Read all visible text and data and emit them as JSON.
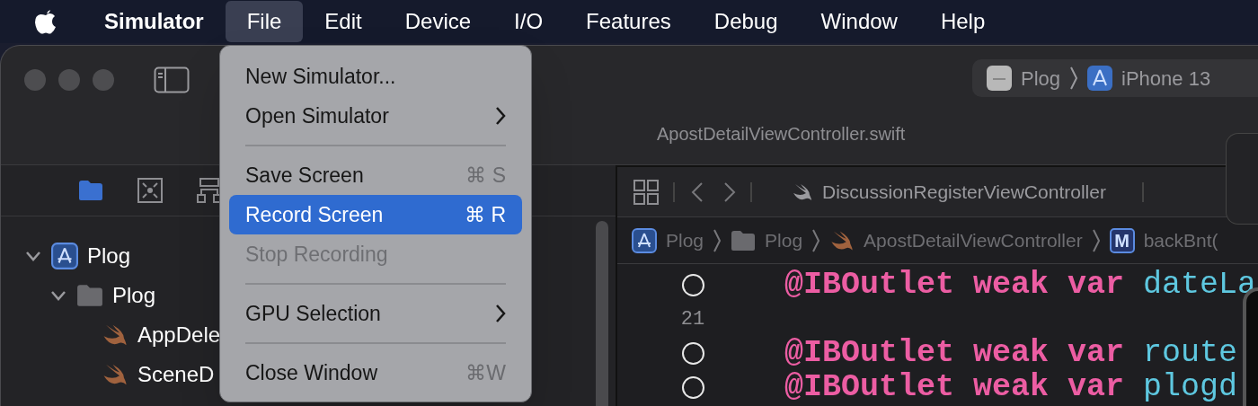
{
  "menubar": {
    "items": [
      {
        "label": "Simulator",
        "kind": "app",
        "selected": false
      },
      {
        "label": "File",
        "kind": "menu",
        "selected": true
      },
      {
        "label": "Edit",
        "kind": "menu",
        "selected": false
      },
      {
        "label": "Device",
        "kind": "menu",
        "selected": false
      },
      {
        "label": "I/O",
        "kind": "menu",
        "selected": false
      },
      {
        "label": "Features",
        "kind": "menu",
        "selected": false
      },
      {
        "label": "Debug",
        "kind": "menu",
        "selected": false
      },
      {
        "label": "Window",
        "kind": "menu",
        "selected": false
      },
      {
        "label": "Help",
        "kind": "menu",
        "selected": false
      }
    ]
  },
  "file_menu": {
    "items": [
      {
        "kind": "item",
        "label": "New Simulator...",
        "selected": false,
        "disabled": false
      },
      {
        "kind": "submenu",
        "label": "Open Simulator",
        "selected": false,
        "disabled": false
      },
      {
        "kind": "separator"
      },
      {
        "kind": "item",
        "label": "Save Screen",
        "shortcut": "⌘ S",
        "selected": false,
        "disabled": false
      },
      {
        "kind": "item",
        "label": "Record Screen",
        "shortcut": "⌘ R",
        "selected": true,
        "disabled": false
      },
      {
        "kind": "item",
        "label": "Stop Recording",
        "selected": false,
        "disabled": true
      },
      {
        "kind": "separator"
      },
      {
        "kind": "submenu",
        "label": "GPU Selection",
        "selected": false,
        "disabled": false
      },
      {
        "kind": "separator"
      },
      {
        "kind": "item",
        "label": "Close Window",
        "shortcut": "⌘W",
        "selected": false,
        "disabled": false
      }
    ]
  },
  "toolbar": {
    "scheme": {
      "project": "Plog",
      "device": "iPhone 13"
    },
    "file_title": "ApostDetailViewController.swift"
  },
  "navigator": {
    "tree": [
      {
        "label": "Plog",
        "kind": "project",
        "expanded": true,
        "children": [
          {
            "label": "Plog",
            "kind": "folder",
            "expanded": true,
            "children": [
              {
                "label": "AppDele",
                "kind": "swift"
              },
              {
                "label": "SceneD",
                "kind": "swift"
              }
            ]
          }
        ]
      }
    ]
  },
  "editor": {
    "tab": "DiscussionRegisterViewController",
    "jump_bar": [
      {
        "label": "Plog",
        "kind": "project"
      },
      {
        "label": "Plog",
        "kind": "folder"
      },
      {
        "label": "ApostDetailViewController",
        "kind": "swift"
      },
      {
        "label": "backBnt(",
        "kind": "method",
        "badge": "M"
      }
    ],
    "lines": [
      {
        "kind": "outlet",
        "keyword": "@IBOutlet weak var",
        "name": "dateLa"
      },
      {
        "kind": "number",
        "number": "21"
      },
      {
        "kind": "outlet",
        "keyword": "@IBOutlet weak var",
        "name": "route"
      },
      {
        "kind": "outlet",
        "keyword": "@IBOutlet weak var",
        "name": "plogd"
      }
    ]
  }
}
